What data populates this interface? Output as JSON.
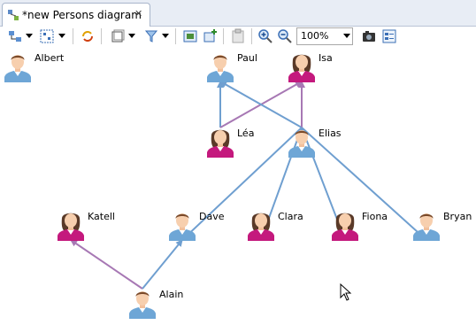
{
  "tab": {
    "title": "*new Persons diagram"
  },
  "toolbar": {
    "zoom_value": "100%"
  },
  "colors": {
    "male": "#6ea6d6",
    "female": "#c4197d",
    "edge_blue": "#6f9fd0",
    "edge_purple": "#a778b4"
  },
  "diagram": {
    "persons": [
      {
        "id": "albert",
        "name": "Albert",
        "gender": "male"
      },
      {
        "id": "paul",
        "name": "Paul",
        "gender": "male"
      },
      {
        "id": "isa",
        "name": "Isa",
        "gender": "female"
      },
      {
        "id": "lea",
        "name": "Léa",
        "gender": "female"
      },
      {
        "id": "elias",
        "name": "Elias",
        "gender": "male"
      },
      {
        "id": "katell",
        "name": "Katell",
        "gender": "female"
      },
      {
        "id": "dave",
        "name": "Dave",
        "gender": "male"
      },
      {
        "id": "clara",
        "name": "Clara",
        "gender": "female"
      },
      {
        "id": "fiona",
        "name": "Fiona",
        "gender": "female"
      },
      {
        "id": "bryan",
        "name": "Bryan",
        "gender": "male"
      },
      {
        "id": "alain",
        "name": "Alain",
        "gender": "male"
      }
    ],
    "links": [
      {
        "from": "lea",
        "to": "paul",
        "color": "edge_blue"
      },
      {
        "from": "lea",
        "to": "isa",
        "color": "edge_purple"
      },
      {
        "from": "elias",
        "to": "paul",
        "color": "edge_blue"
      },
      {
        "from": "elias",
        "to": "isa",
        "color": "edge_purple"
      },
      {
        "from": "elias",
        "to": "dave",
        "color": "edge_blue"
      },
      {
        "from": "elias",
        "to": "clara",
        "color": "edge_blue"
      },
      {
        "from": "elias",
        "to": "fiona",
        "color": "edge_blue"
      },
      {
        "from": "elias",
        "to": "bryan",
        "color": "edge_blue"
      },
      {
        "from": "alain",
        "to": "katell",
        "color": "edge_purple"
      },
      {
        "from": "alain",
        "to": "dave",
        "color": "edge_blue"
      }
    ]
  }
}
